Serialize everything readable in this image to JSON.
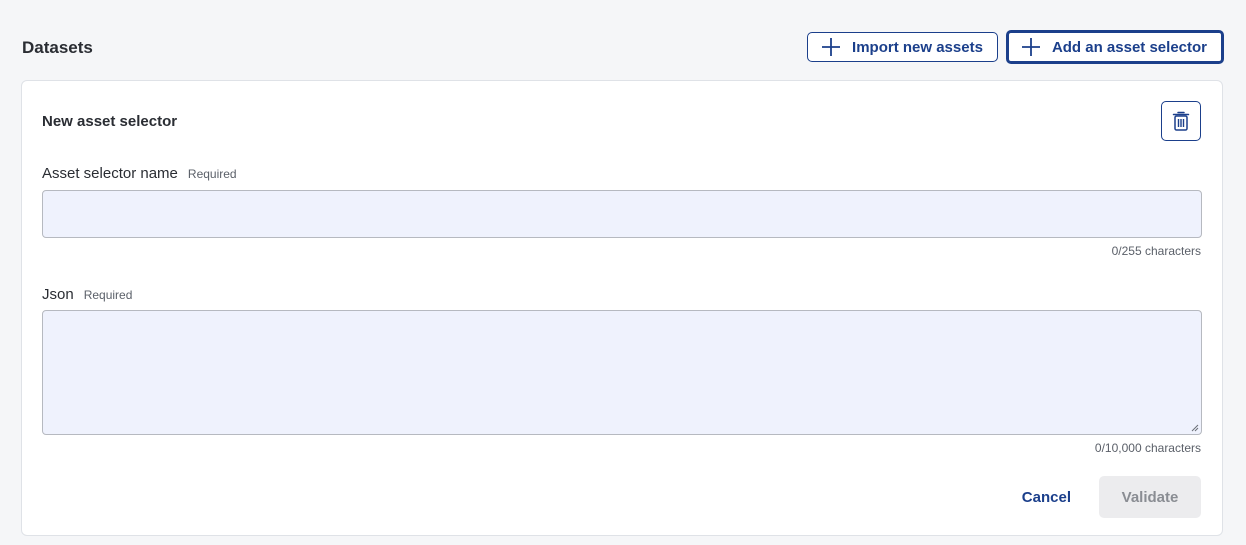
{
  "page": {
    "title": "Datasets"
  },
  "toolbar": {
    "import_label": "Import new assets",
    "add_selector_label": "Add an asset selector",
    "import_icon": "plus-icon",
    "add_icon": "plus-icon"
  },
  "card": {
    "title": "New asset selector",
    "delete_icon": "trash-icon"
  },
  "fields": {
    "name": {
      "label": "Asset selector name",
      "required": "Required",
      "value": "",
      "placeholder": "",
      "counter": "0/255 characters"
    },
    "json": {
      "label": "Json",
      "required": "Required",
      "value": "",
      "placeholder": "",
      "counter": "0/10,000 characters"
    }
  },
  "footer": {
    "cancel_label": "Cancel",
    "validate_label": "Validate"
  },
  "colors": {
    "accent": "#1b3f8b",
    "input_bg": "#eff2fd",
    "page_bg": "#f5f6f8",
    "disabled_bg": "#ececee"
  }
}
